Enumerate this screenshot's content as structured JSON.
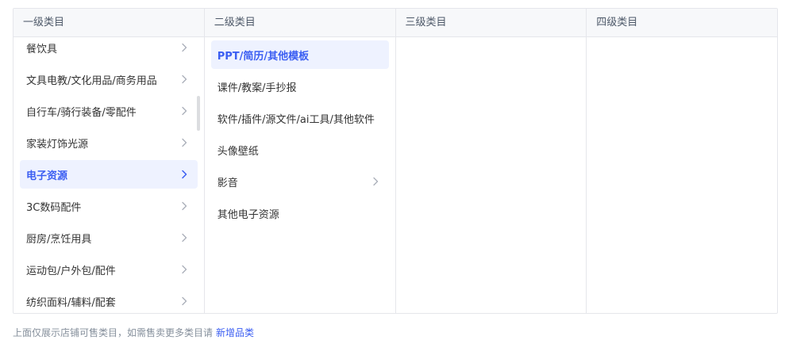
{
  "columns": {
    "level1": {
      "header": "一级类目",
      "items": [
        {
          "label": "餐饮具"
        },
        {
          "label": "文具电教/文化用品/商务用品"
        },
        {
          "label": "自行车/骑行装备/零配件"
        },
        {
          "label": "家装灯饰光源"
        },
        {
          "label": "电子资源"
        },
        {
          "label": "3C数码配件"
        },
        {
          "label": "厨房/烹饪用具"
        },
        {
          "label": "运动包/户外包/配件"
        },
        {
          "label": "纺织面料/辅料/配套"
        }
      ],
      "selected_index": 4
    },
    "level2": {
      "header": "二级类目",
      "items": [
        {
          "label": "PPT/简历/其他模板"
        },
        {
          "label": "课件/教案/手抄报"
        },
        {
          "label": "软件/插件/源文件/ai工具/其他软件"
        },
        {
          "label": "头像壁纸"
        },
        {
          "label": "影音"
        },
        {
          "label": "其他电子资源"
        }
      ],
      "selected_index": 0
    },
    "level3": {
      "header": "三级类目"
    },
    "level4": {
      "header": "四级类目"
    }
  },
  "footer": {
    "note": "上面仅展示店铺可售类目，如需售卖更多类目请",
    "link": "新增品类"
  },
  "icons": {
    "chevron": "chevron-right-icon"
  },
  "colors": {
    "accent": "#3b5ef2",
    "selected_bg": "#eef2ff",
    "header_bg": "#f7f8fa",
    "border": "#e5e6eb"
  }
}
